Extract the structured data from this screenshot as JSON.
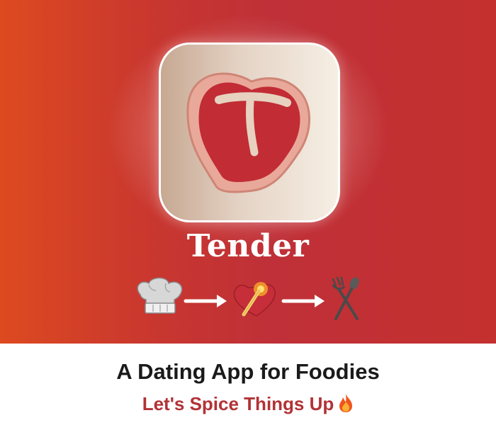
{
  "app": {
    "name": "Tender",
    "icon": "steak-heart-icon"
  },
  "flow": {
    "steps": [
      "chef-hat-icon",
      "arrow-right-icon",
      "lit-match-heart-icon",
      "arrow-right-icon",
      "fork-spoon-icon"
    ]
  },
  "footer": {
    "tagline": "A Dating App for Foodies",
    "subtagline": "Let's Spice Things Up",
    "subtagline_icon": "fire-icon"
  },
  "colors": {
    "hero_left": "#dd4a20",
    "hero_right": "#c4302e",
    "accent": "#b23235",
    "tagline": "#1a1a1a"
  }
}
